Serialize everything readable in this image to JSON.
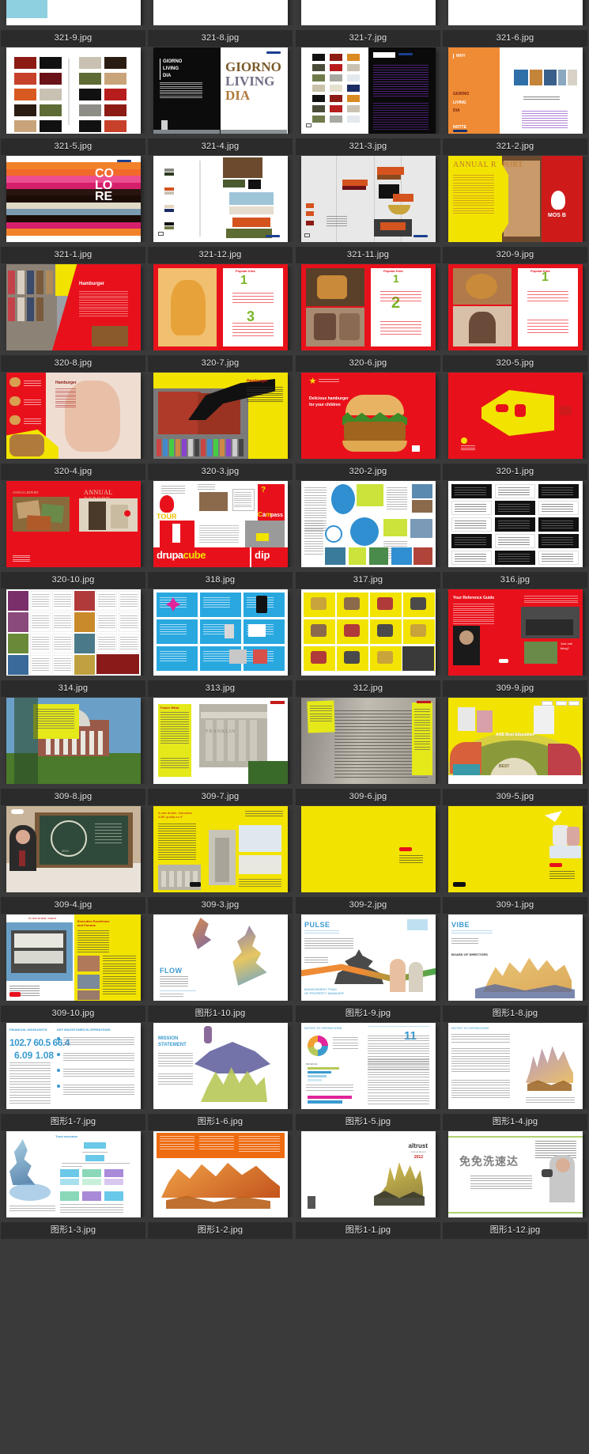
{
  "view": {
    "type": "image-thumbnail-grid",
    "background_color": "#3a3a3a",
    "label_bar_color": "#2b2b2b",
    "label_text_color": "#e6e6e6",
    "columns": 4,
    "visible_rows": 14,
    "first_row_is_clipped": true
  },
  "items": [
    {
      "filename": "321-9.jpg",
      "art": "a-teal-red",
      "label_visible": true,
      "clipped": true
    },
    {
      "filename": "321-8.jpg",
      "art": "b-swatch-wood",
      "label_visible": true,
      "clipped": true
    },
    {
      "filename": "321-7.jpg",
      "art": "c-brown-photo",
      "label_visible": true,
      "clipped": true
    },
    {
      "filename": "321-6.jpg",
      "art": "d-navy-blocks",
      "label_visible": true,
      "clipped": true
    },
    {
      "filename": "321-5.jpg",
      "art": "swatch-grid-warm"
    },
    {
      "filename": "321-4.jpg",
      "art": "giorno-living-dia"
    },
    {
      "filename": "321-3.jpg",
      "art": "swatch-black-purple"
    },
    {
      "filename": "321-2.jpg",
      "art": "why-orange"
    },
    {
      "filename": "321-1.jpg",
      "art": "colore-stripes"
    },
    {
      "filename": "321-12.jpg",
      "art": "material-board"
    },
    {
      "filename": "321-11.jpg",
      "art": "furniture-grey"
    },
    {
      "filename": "320-9.jpg",
      "art": "annual-report-mos"
    },
    {
      "filename": "320-8.jpg",
      "art": "hamburger-street"
    },
    {
      "filename": "320-7.jpg",
      "art": "chips-red-3"
    },
    {
      "filename": "320-6.jpg",
      "art": "people-red-2"
    },
    {
      "filename": "320-5.jpg",
      "art": "woman-red-1"
    },
    {
      "filename": "320-4.jpg",
      "art": "child-burger-yellow"
    },
    {
      "filename": "320-3.jpg",
      "art": "crowd-yellow-burger"
    },
    {
      "filename": "320-2.jpg",
      "art": "big-burger-red"
    },
    {
      "filename": "320-1.jpg",
      "art": "yellow-shape-red"
    },
    {
      "filename": "320-10.jpg",
      "art": "annual-report-red"
    },
    {
      "filename": "318.jpg",
      "art": "drupa-cube-dip"
    },
    {
      "filename": "317.jpg",
      "art": "blue-circles-spread"
    },
    {
      "filename": "316.jpg",
      "art": "bw-grid"
    },
    {
      "filename": "314.jpg",
      "art": "magazine-grid-people"
    },
    {
      "filename": "313.jpg",
      "art": "cyan-grid"
    },
    {
      "filename": "312.jpg",
      "art": "yellow-grid"
    },
    {
      "filename": "309-9.jpg",
      "art": "red-portrait-spread"
    },
    {
      "filename": "309-8.jpg",
      "art": "rotunda-yellow"
    },
    {
      "filename": "309-7.jpg",
      "art": "franklin-yellow"
    },
    {
      "filename": "309-6.jpg",
      "art": "wall-names-yellow"
    },
    {
      "filename": "309-5.jpg",
      "art": "best-education-fan"
    },
    {
      "filename": "309-4.jpg",
      "art": "student-chalkboard"
    },
    {
      "filename": "309-3.jpg",
      "art": "yellow-campus-spread"
    },
    {
      "filename": "309-2.jpg",
      "art": "plain-yellow"
    },
    {
      "filename": "309-1.jpg",
      "art": "yellow-students-book"
    },
    {
      "filename": "309-10.jpg",
      "art": "campus-yellow-spread"
    },
    {
      "filename": "图形1-10.jpg",
      "art": "flow-watercolor"
    },
    {
      "filename": "图形1-9.jpg",
      "art": "pulse-watercolor"
    },
    {
      "filename": "图形1-8.jpg",
      "art": "vibe-watercolor"
    },
    {
      "filename": "图形1-7.jpg",
      "art": "financial-highlights"
    },
    {
      "filename": "图形1-6.jpg",
      "art": "mission-statement"
    },
    {
      "filename": "图形1-5.jpg",
      "art": "report-charts"
    },
    {
      "filename": "图形1-4.jpg",
      "art": "report-castle"
    },
    {
      "filename": "图形1-3.jpg",
      "art": "org-chart-blue"
    },
    {
      "filename": "图形1-2.jpg",
      "art": "orange-opera"
    },
    {
      "filename": "图形1-1.jpg",
      "art": "altrust-cover"
    },
    {
      "filename": "图形1-12.jpg",
      "art": "green-swirl-camera"
    }
  ]
}
